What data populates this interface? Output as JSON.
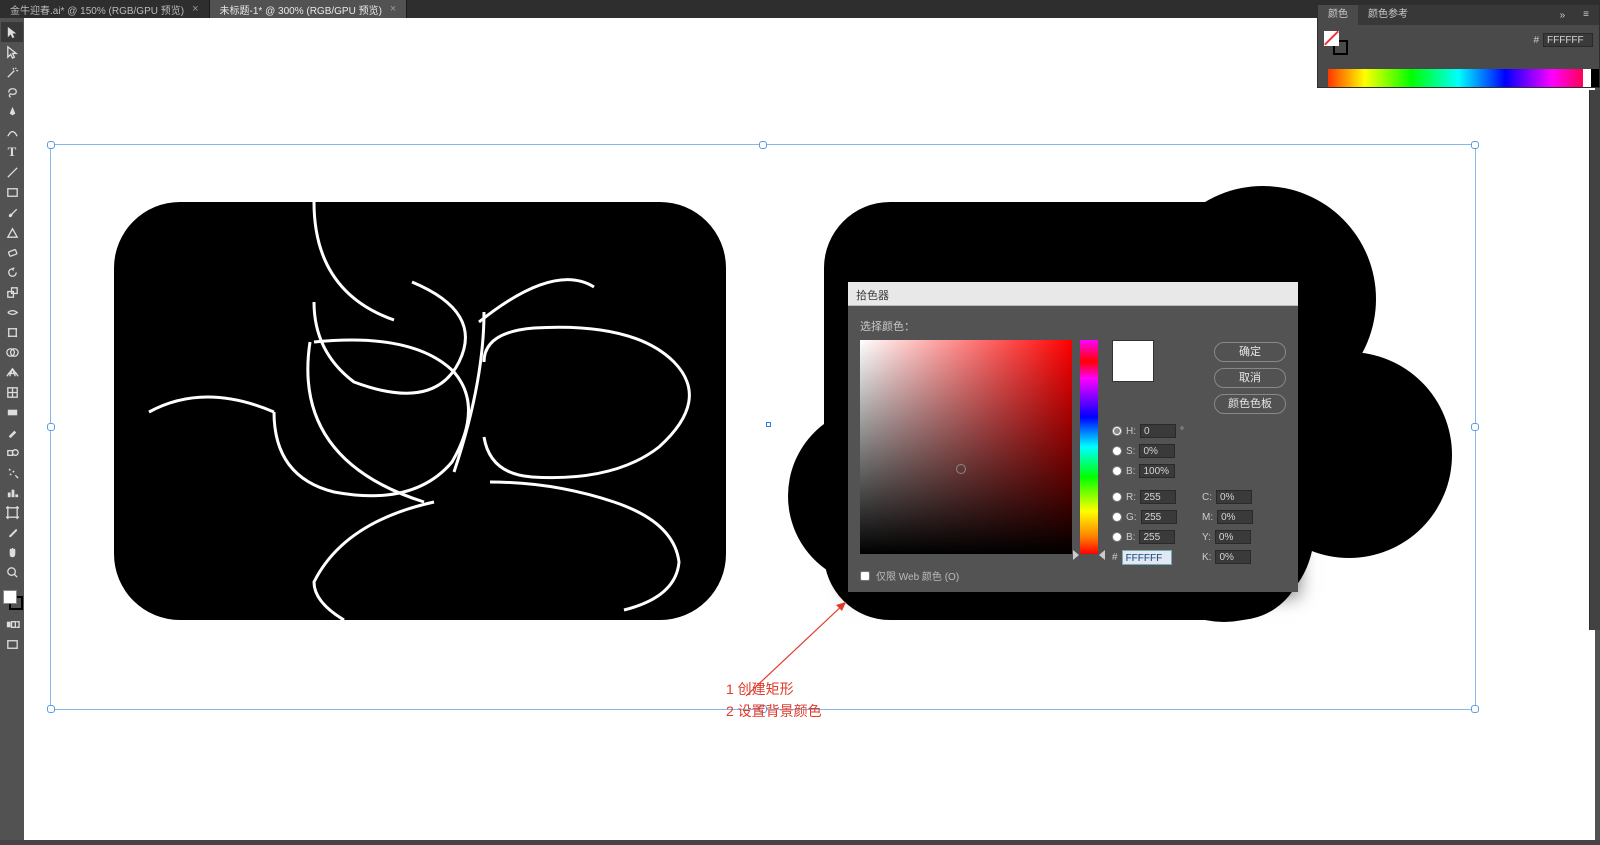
{
  "tabs": [
    {
      "label": "金牛迎春.ai* @ 150% (RGB/GPU 预览)",
      "active": false
    },
    {
      "label": "未标题-1* @ 300% (RGB/GPU 预览)",
      "active": true
    }
  ],
  "picker": {
    "title": "拾色器",
    "select_label": "选择颜色：",
    "ok": "确定",
    "cancel": "取消",
    "swatches": "颜色色板",
    "H": {
      "label": "H:",
      "value": "0",
      "unit": "°"
    },
    "S": {
      "label": "S:",
      "value": "0%",
      "unit": ""
    },
    "Bv": {
      "label": "B:",
      "value": "100%",
      "unit": ""
    },
    "R": {
      "label": "R:",
      "value": "255",
      "unit": ""
    },
    "G": {
      "label": "G:",
      "value": "255",
      "unit": ""
    },
    "B": {
      "label": "B:",
      "value": "255",
      "unit": ""
    },
    "C": {
      "label": "C:",
      "value": "0%",
      "unit": ""
    },
    "M": {
      "label": "M:",
      "value": "0%",
      "unit": ""
    },
    "Y": {
      "label": "Y:",
      "value": "0%",
      "unit": ""
    },
    "K": {
      "label": "K:",
      "value": "0%",
      "unit": ""
    },
    "hex_label": "#",
    "hex": "FFFFFF",
    "web_only": "仅限 Web 颜色 (O)"
  },
  "color_panel": {
    "tab1": "颜色",
    "tab2": "颜色参考",
    "more": "»",
    "menu": "≡",
    "hex_label": "#",
    "hex": "FFFFFF"
  },
  "annotation": {
    "line1": "1 创建矩形",
    "line2": "2 设置背景颜色"
  }
}
